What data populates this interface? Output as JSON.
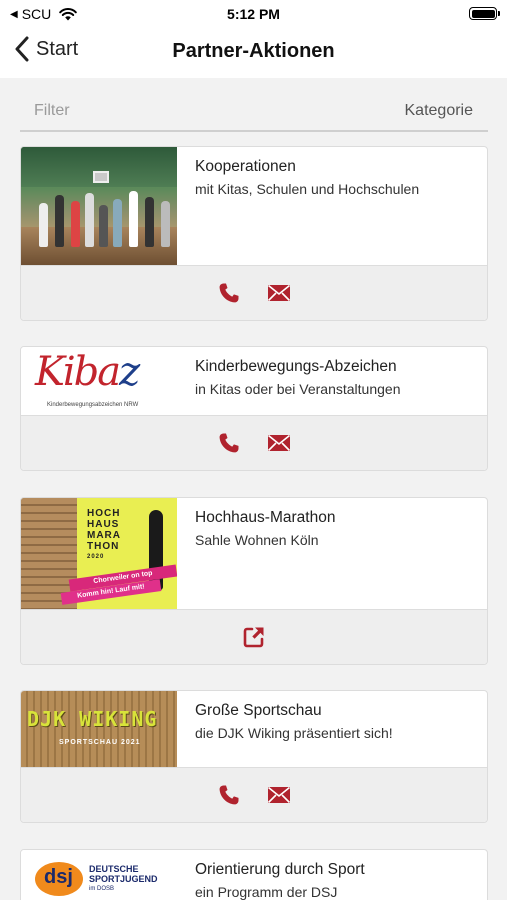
{
  "status_bar": {
    "back_glyph": "◀",
    "carrier": "SCU",
    "time": "5:12 PM"
  },
  "nav": {
    "back_label": "Start",
    "title": "Partner-Aktionen"
  },
  "filter": {
    "filter_label": "Filter",
    "category_label": "Kategorie"
  },
  "cards": [
    {
      "title": "Kooperationen",
      "subtitle": "mit Kitas, Schulen und Hochschulen",
      "actions": [
        "phone-icon",
        "mail-icon"
      ]
    },
    {
      "title": "Kinderbewegungs-Abzeichen",
      "subtitle": "in Kitas oder bei Veranstaltungen",
      "actions": [
        "phone-icon",
        "mail-icon"
      ],
      "logo_text": "Kibaz",
      "logo_sub": "Kinderbewegungsabzeichen NRW"
    },
    {
      "title": "Hochhaus-Marathon",
      "subtitle": "Sahle Wohnen Köln",
      "actions": [
        "external-link-icon"
      ],
      "poster_lines": [
        "HOCH",
        "HAUS",
        "MARA",
        "THON"
      ],
      "poster_year": "2020",
      "banner_1": "Chorweiler on top",
      "banner_2": "Komm hin! Lauf mit!"
    },
    {
      "title": "Große Sportschau",
      "subtitle": "die DJK Wiking präsentiert sich!",
      "actions": [
        "phone-icon",
        "mail-icon"
      ],
      "sign_text": "DJK WIKING",
      "sign_sub": "SPORTSCHAU 2021"
    },
    {
      "title": "Orientierung durch Sport",
      "subtitle": "ein Programm der DSJ",
      "logo_mark": "dsj",
      "logo_lines": [
        "DEUTSCHE",
        "SPORTJUGEND",
        "im DOSB"
      ]
    }
  ],
  "colors": {
    "accent": "#b0232e",
    "background": "#f2f2f2"
  }
}
